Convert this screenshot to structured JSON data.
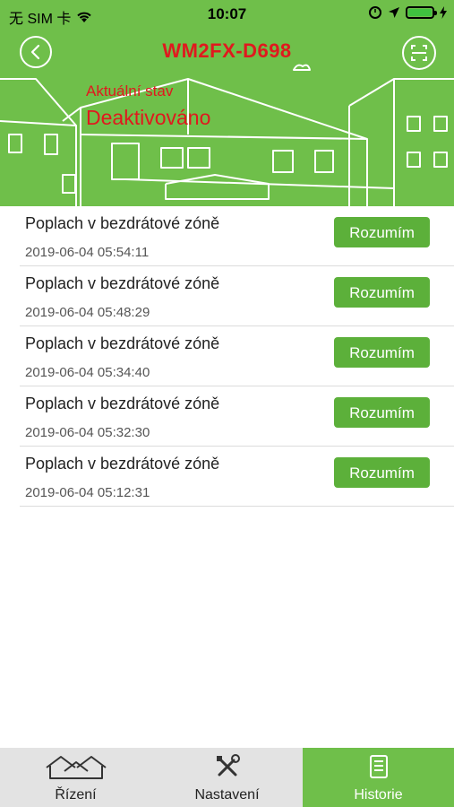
{
  "status_bar": {
    "carrier": "无 SIM 卡",
    "time": "10:07"
  },
  "header": {
    "device_name": "WM2FX-D698",
    "state_label": "Aktuální stav",
    "state_value": "Deaktivováno",
    "back_icon": "back-arrow-icon",
    "scan_icon": "scan-icon"
  },
  "alarms": [
    {
      "title": "Poplach v bezdrátové zóně",
      "time": "2019-06-04 05:54:11",
      "button": "Rozumím"
    },
    {
      "title": "Poplach v bezdrátové zóně",
      "time": "2019-06-04 05:48:29",
      "button": "Rozumím"
    },
    {
      "title": "Poplach v bezdrátové zóně",
      "time": "2019-06-04 05:34:40",
      "button": "Rozumím"
    },
    {
      "title": "Poplach v bezdrátové zóně",
      "time": "2019-06-04 05:32:30",
      "button": "Rozumím"
    },
    {
      "title": "Poplach v bezdrátové zóně",
      "time": "2019-06-04 05:12:31",
      "button": "Rozumím"
    }
  ],
  "tabs": [
    {
      "label": "Řízení",
      "icon": "houses-icon",
      "active": false
    },
    {
      "label": "Nastavení",
      "icon": "tools-icon",
      "active": false
    },
    {
      "label": "Historie",
      "icon": "document-icon",
      "active": true
    }
  ],
  "colors": {
    "accent_green": "#6fbf4a",
    "button_green": "#5cb03a",
    "alert_red": "#e0191e"
  }
}
